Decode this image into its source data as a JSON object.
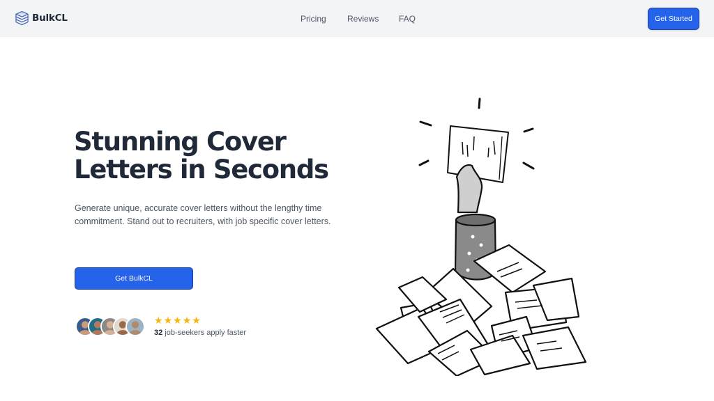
{
  "header": {
    "logo_text": "BulkCL",
    "nav": [
      "Pricing",
      "Reviews",
      "FAQ"
    ],
    "cta_label": "Get Started"
  },
  "hero": {
    "title_line1": "Stunning Cover",
    "title_line2": "Letters in Seconds",
    "description": "Generate unique, accurate cover letters without the lengthy time commitment. Stand out to recruiters, with job specific cover letters.",
    "cta_label": "Get BulkCL"
  },
  "social_proof": {
    "rating_stars": 5,
    "star_glyph": "★",
    "count": "32",
    "text": "job-seekers apply faster",
    "avatars": [
      {
        "bg": "#3b5b8a",
        "skin": "#c99b7a"
      },
      {
        "bg": "#1f6f8b",
        "skin": "#b27a5a"
      },
      {
        "bg": "#8d8a86",
        "skin": "#d8b096"
      },
      {
        "bg": "#e3d9cc",
        "skin": "#9a6a48"
      },
      {
        "bg": "#9bb3c7",
        "skin": "#b08a6a"
      }
    ]
  },
  "colors": {
    "accent": "#2563eb",
    "star": "#f5b50a",
    "header_bg": "#f3f4f6"
  },
  "icons": {
    "logo": "stacked-layers-icon",
    "rating": "star-icon"
  }
}
